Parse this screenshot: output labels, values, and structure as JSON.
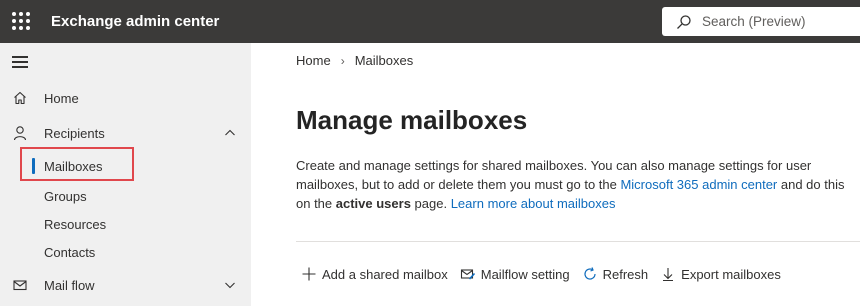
{
  "header": {
    "app_title": "Exchange admin center",
    "search_placeholder": "Search (Preview)"
  },
  "sidebar": {
    "items": [
      {
        "label": "Home",
        "icon": "home-icon"
      },
      {
        "label": "Recipients",
        "icon": "person-icon",
        "expanded": true
      },
      {
        "label": "Mail flow",
        "icon": "mail-icon",
        "expanded": false
      }
    ],
    "recipients_children": [
      {
        "label": "Mailboxes",
        "active": true
      },
      {
        "label": "Groups"
      },
      {
        "label": "Resources"
      },
      {
        "label": "Contacts"
      }
    ]
  },
  "breadcrumb": {
    "home": "Home",
    "current": "Mailboxes"
  },
  "main": {
    "title": "Manage mailboxes",
    "description_part1": "Create and manage settings for shared mailboxes. You can also manage settings for user mailboxes, but to add or delete them you must go to the ",
    "admin_center_link": "Microsoft 365 admin center",
    "description_part2": " and do this on the ",
    "active_users_bold": "active users",
    "description_part3": " page. ",
    "learn_more_link": "Learn more about mailboxes"
  },
  "toolbar": {
    "add_shared_label": "Add a shared mailbox",
    "mailflow_label": "Mailflow setting",
    "refresh_label": "Refresh",
    "export_label": "Export mailboxes"
  },
  "colors": {
    "topbar": "#3b3a39",
    "sidebar": "#f0f0f0",
    "link": "#0f6cbd",
    "highlight": "#e0474c"
  }
}
